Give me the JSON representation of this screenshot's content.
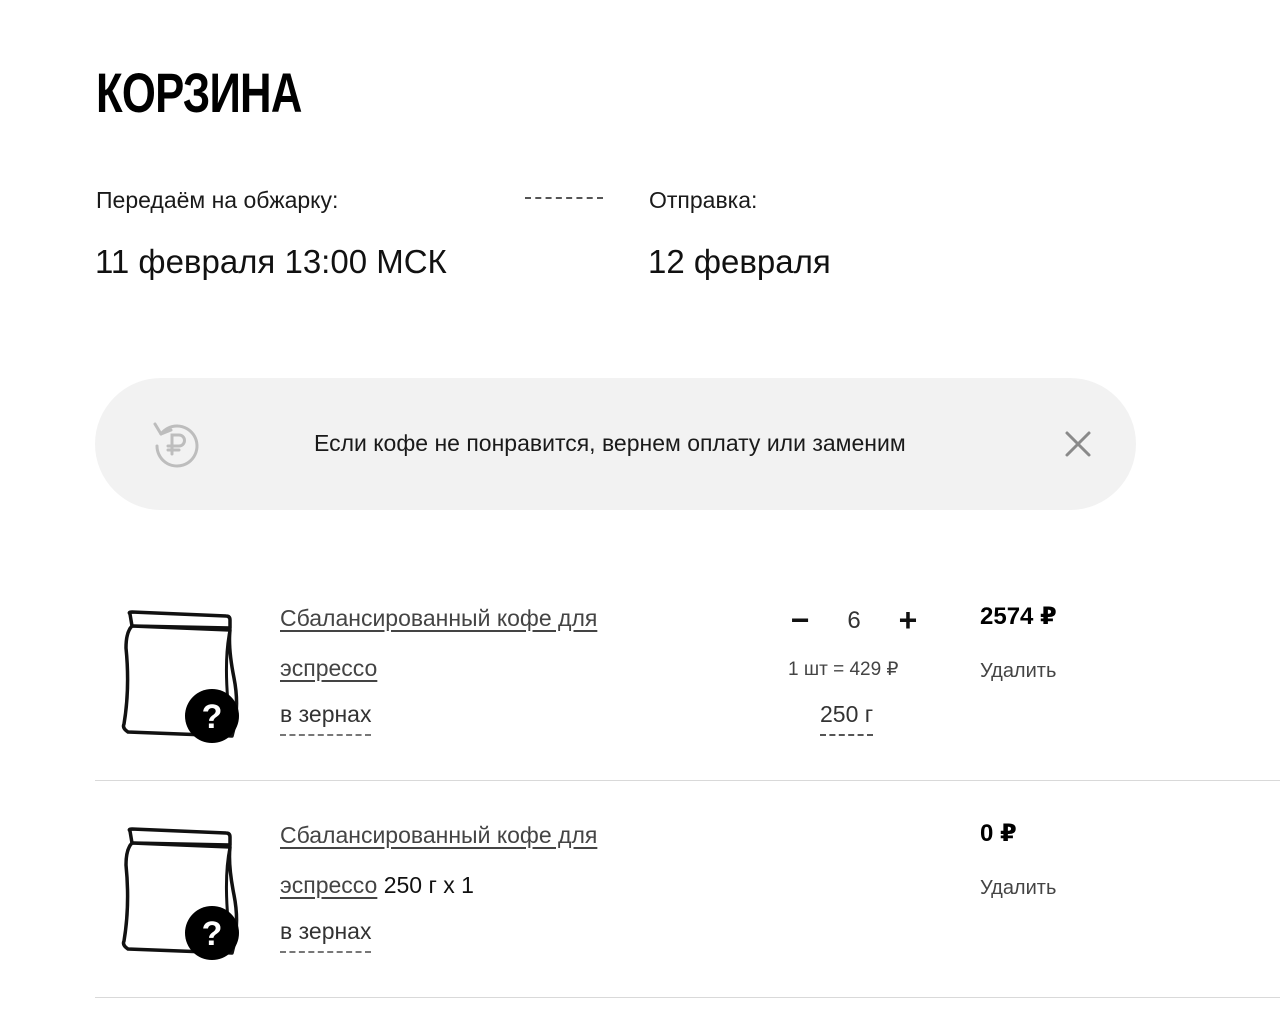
{
  "page": {
    "title": "КОРЗИНА"
  },
  "schedule": {
    "roast_label": "Передаём на обжарку:",
    "roast_value": "11 февраля 13:00 МСК",
    "ship_label": "Отправка:",
    "ship_value": "12 февраля"
  },
  "banner": {
    "icon": "ruble-refund-icon",
    "text": "Если кофе не понравится, вернем оплату или заменим",
    "close_icon": "close-icon"
  },
  "items": [
    {
      "name_line1": "Сбалансированный кофе для",
      "name_line2": "эспрессо",
      "grind": "в зернах",
      "minus_label": "−",
      "quantity": "6",
      "plus_label": "+",
      "unit_price": "1 шт = 429 ₽",
      "weight": "250 г",
      "price": "2574 ₽",
      "delete_label": "Удалить"
    },
    {
      "name_line1": "Сбалансированный кофе для",
      "name_line2": "эспрессо",
      "name_suffix": " 250 г x 1",
      "grind": "в зернах",
      "price": "0 ₽",
      "delete_label": "Удалить"
    }
  ],
  "colors": {
    "banner_bg": "#f2f2f2",
    "text": "#111111",
    "muted": "#444444",
    "divider": "#d9d9d9"
  }
}
